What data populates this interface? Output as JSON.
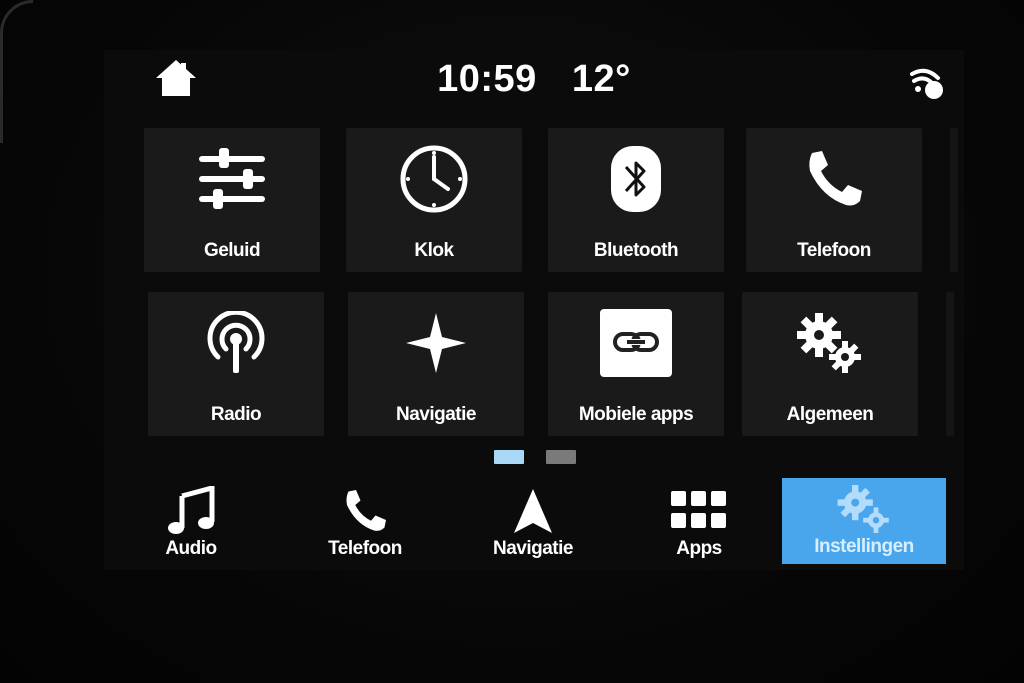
{
  "status": {
    "time": "10:59",
    "temperature": "12°"
  },
  "tiles": [
    {
      "label": "Geluid",
      "icon": "sliders-icon"
    },
    {
      "label": "Klok",
      "icon": "clock-icon"
    },
    {
      "label": "Bluetooth",
      "icon": "bluetooth-icon"
    },
    {
      "label": "Telefoon",
      "icon": "phone-icon"
    },
    {
      "label": "Radio",
      "icon": "radio-antenna-icon"
    },
    {
      "label": "Navigatie",
      "icon": "compass-star-icon"
    },
    {
      "label": "Mobiele apps",
      "icon": "link-icon"
    },
    {
      "label": "Algemeen",
      "icon": "gears-icon"
    }
  ],
  "pagination": {
    "pages": 2,
    "current": 1
  },
  "bottom_nav": [
    {
      "label": "Audio",
      "icon": "music-note-icon"
    },
    {
      "label": "Telefoon",
      "icon": "phone-icon"
    },
    {
      "label": "Navigatie",
      "icon": "navigation-arrow-icon"
    },
    {
      "label": "Apps",
      "icon": "apps-grid-icon"
    },
    {
      "label": "Instellingen",
      "icon": "gears-icon",
      "active": true
    }
  ],
  "colors": {
    "accent": "#4aa6ec",
    "tile": "#1a1a1a",
    "dot_active": "#a9d8f7",
    "dot_inactive": "#7a7a7a"
  }
}
